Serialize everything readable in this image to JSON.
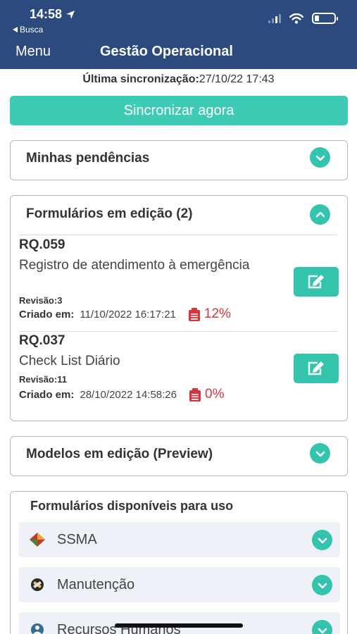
{
  "status_bar": {
    "time": "14:58",
    "back_app": "Busca"
  },
  "nav": {
    "menu": "Menu",
    "title": "Gestão Operacional"
  },
  "sync": {
    "label": "Última sincronização:",
    "value": "27/10/22 17:43",
    "button": "Sincronizar agora"
  },
  "sections": {
    "pendencias": "Minhas pendências",
    "editing": "Formulários em edição (2)",
    "models": "Modelos em edição (Preview)",
    "available": "Formulários disponíveis para uso"
  },
  "forms_in_edit": [
    {
      "code": "RQ.059",
      "name": "Registro de atendimento à emergência",
      "revision": "Revisão:3",
      "created_label": "Criado em:",
      "created": "11/10/2022 16:17:21",
      "progress": "12%"
    },
    {
      "code": "RQ.037",
      "name": "Check List Diário",
      "revision": "Revisão:11",
      "created_label": "Criado em:",
      "created": "28/10/2022 14:58:26",
      "progress": "0%"
    }
  ],
  "available_categories": [
    {
      "label": "SSMA",
      "icon": "ssma-icon"
    },
    {
      "label": "Manutenção",
      "icon": "maintenance-icon"
    },
    {
      "label": "Recursos Humanos",
      "icon": "hr-icon"
    }
  ],
  "colors": {
    "nav": "#2c4a7e",
    "accent": "#33c4ae",
    "progress": "#d6353d"
  }
}
